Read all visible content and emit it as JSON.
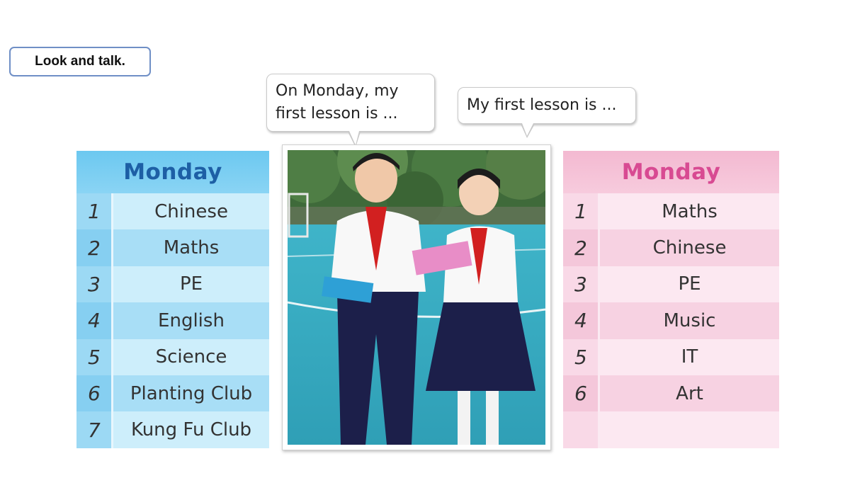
{
  "instruction": "Look and talk.",
  "bubbles": {
    "left": "On Monday, my first lesson is ...",
    "right": "My first lesson is ..."
  },
  "timetable_left": {
    "title": "Monday",
    "color": "#1d5fa5",
    "rows": [
      {
        "num": "1",
        "subject": "Chinese"
      },
      {
        "num": "2",
        "subject": "Maths"
      },
      {
        "num": "3",
        "subject": "PE"
      },
      {
        "num": "4",
        "subject": "English"
      },
      {
        "num": "5",
        "subject": "Science"
      },
      {
        "num": "6",
        "subject": "Planting Club"
      },
      {
        "num": "7",
        "subject": "Kung Fu Club"
      }
    ]
  },
  "timetable_right": {
    "title": "Monday",
    "color": "#d84a92",
    "rows": [
      {
        "num": "1",
        "subject": "Maths"
      },
      {
        "num": "2",
        "subject": "Chinese"
      },
      {
        "num": "3",
        "subject": "PE"
      },
      {
        "num": "4",
        "subject": "Music"
      },
      {
        "num": "5",
        "subject": "IT"
      },
      {
        "num": "6",
        "subject": "Art"
      },
      {
        "num": "",
        "subject": ""
      }
    ]
  },
  "photo": {
    "icon": "two-students-reading-timetables-photo"
  }
}
